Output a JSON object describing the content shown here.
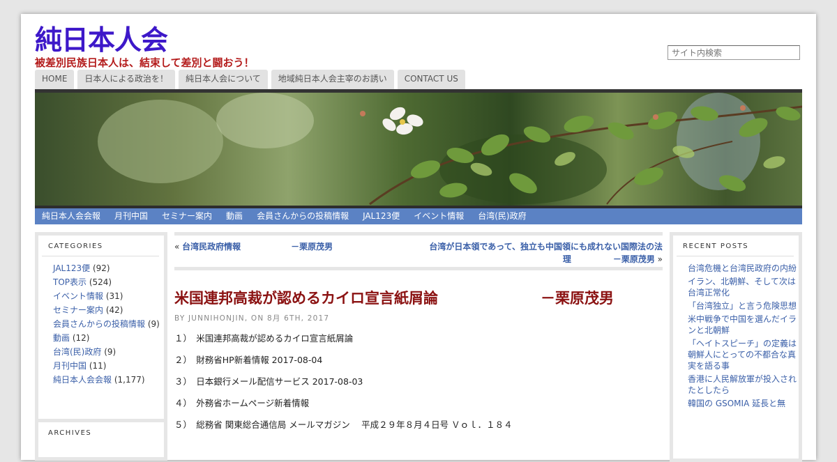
{
  "site": {
    "title": "純日本人会",
    "description": "被差別民族日本人は、結束して差別と闘おう！"
  },
  "search": {
    "placeholder": "サイト内検索"
  },
  "main_nav": [
    "HOME",
    "日本人による政治を！",
    "純日本人会について",
    "地域純日本人会主宰のお誘い",
    "CONTACT US"
  ],
  "category_nav": [
    "純日本人会会報",
    "月刊中国",
    "セミナー案内",
    "動画",
    "会員さんからの投稿情報",
    "JAL123便",
    "イベント情報",
    "台湾(民)政府"
  ],
  "categories_widget": {
    "title": "CATEGORIES",
    "items": [
      {
        "label": "JAL123便",
        "count": "(92)"
      },
      {
        "label": "TOP表示",
        "count": "(524)"
      },
      {
        "label": "イベント情報",
        "count": "(31)"
      },
      {
        "label": "セミナー案内",
        "count": "(42)"
      },
      {
        "label": "会員さんからの投稿情報",
        "count": "(9)"
      },
      {
        "label": "動画",
        "count": "(12)"
      },
      {
        "label": "台湾(民)政府",
        "count": "(9)"
      },
      {
        "label": "月刊中国",
        "count": "(11)"
      },
      {
        "label": "純日本人会会報",
        "count": "(1,177)"
      }
    ]
  },
  "archives_widget": {
    "title": "ARCHIVES"
  },
  "recent_posts_widget": {
    "title": "RECENT POSTS",
    "items": [
      "台湾危機と台湾民政府の内紛",
      "イラン、北朝鮮、そして次は台湾正常化",
      "「台湾独立」と言う危険思想",
      "米中戦争で中国を選んだイランと北朝鮮",
      "「ヘイトスピーチ」の定義は朝鮮人にとっての不都合な真実を語る事",
      "香港に人民解放軍が投入されたとしたら",
      "韓国の GSOMIA 延長と無"
    ]
  },
  "post_navigation": {
    "prev_arrow": "«",
    "prev_title": "台湾民政府情報　　　　　　－栗原茂男",
    "next_title": "台湾が日本領であって、独立も中国領にも成れない国際法の法理　　　　　－栗原茂男",
    "next_arrow": "»"
  },
  "post": {
    "title": "米国連邦高裁が認めるカイロ宣言紙屑論　　　　　　　－栗原茂男",
    "meta": "BY JUNNIHONJIN, ON 8月 6TH, 2017",
    "items": [
      "１）　米国連邦高裁が認めるカイロ宣言紙屑論",
      "２）　財務省HP新着情報 2017-08-04",
      "３）　日本銀行メール配信サービス 2017-08-03",
      "４）　外務省ホームページ新着情報",
      "５）　総務省 関東総合通信局 メールマガジン　 平成２９年８月４日号 Ｖｏｌ．１８４"
    ]
  }
}
